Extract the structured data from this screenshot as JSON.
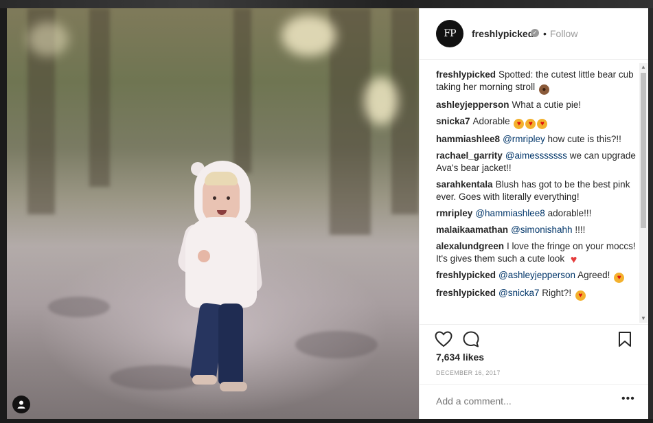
{
  "post": {
    "username": "freshlypicked",
    "avatar_text": "FP",
    "verified_icon": "verified-badge-icon",
    "separator": "•",
    "follow_label": "Follow",
    "likes": "7,634 likes",
    "date": "DECEMBER 16, 2017",
    "add_comment_placeholder": "Add a comment...",
    "more_label": "•••"
  },
  "comments": [
    {
      "user": "freshlypicked",
      "text": "Spotted: the cutest little bear cub taking her morning stroll",
      "emoji": "bear-emoji"
    },
    {
      "user": "ashleyjepperson",
      "text": "What a cutie pie!"
    },
    {
      "user": "snicka7",
      "text": "Adorable",
      "emoji": "heart-eyes-emoji x3"
    },
    {
      "user": "hammiashlee8",
      "mention": "@rmripley",
      "text": "how cute is this?!!"
    },
    {
      "user": "rachael_garrity",
      "mention": "@aimesssssss",
      "text": "we can upgrade Ava's bear jacket!!"
    },
    {
      "user": "sarahkentala",
      "text": "Blush has got to be the best pink ever. Goes with literally everything!"
    },
    {
      "user": "rmripley",
      "mention": "@hammiashlee8",
      "text": "adorable!!!"
    },
    {
      "user": "malaikaamathan",
      "mention": "@simonishahh",
      "text": "!!!!"
    },
    {
      "user": "alexalundgreen",
      "text": "I love the fringe on your moccs! It's gives them such a cute look",
      "emoji": "heart-emoji"
    },
    {
      "user": "freshlypicked",
      "mention": "@ashleyjepperson",
      "text": "Agreed!",
      "emoji": "heart-eyes-emoji"
    },
    {
      "user": "freshlypicked",
      "mention": "@snicka7",
      "text": "Right?!",
      "emoji": "heart-eyes-emoji"
    }
  ],
  "icons": {
    "like": "heart-outline-icon",
    "comment": "speech-bubble-icon",
    "save": "bookmark-icon",
    "tag": "user-tag-icon"
  },
  "colors": {
    "mention": "#003569",
    "muted": "#999999",
    "text": "#262626"
  }
}
